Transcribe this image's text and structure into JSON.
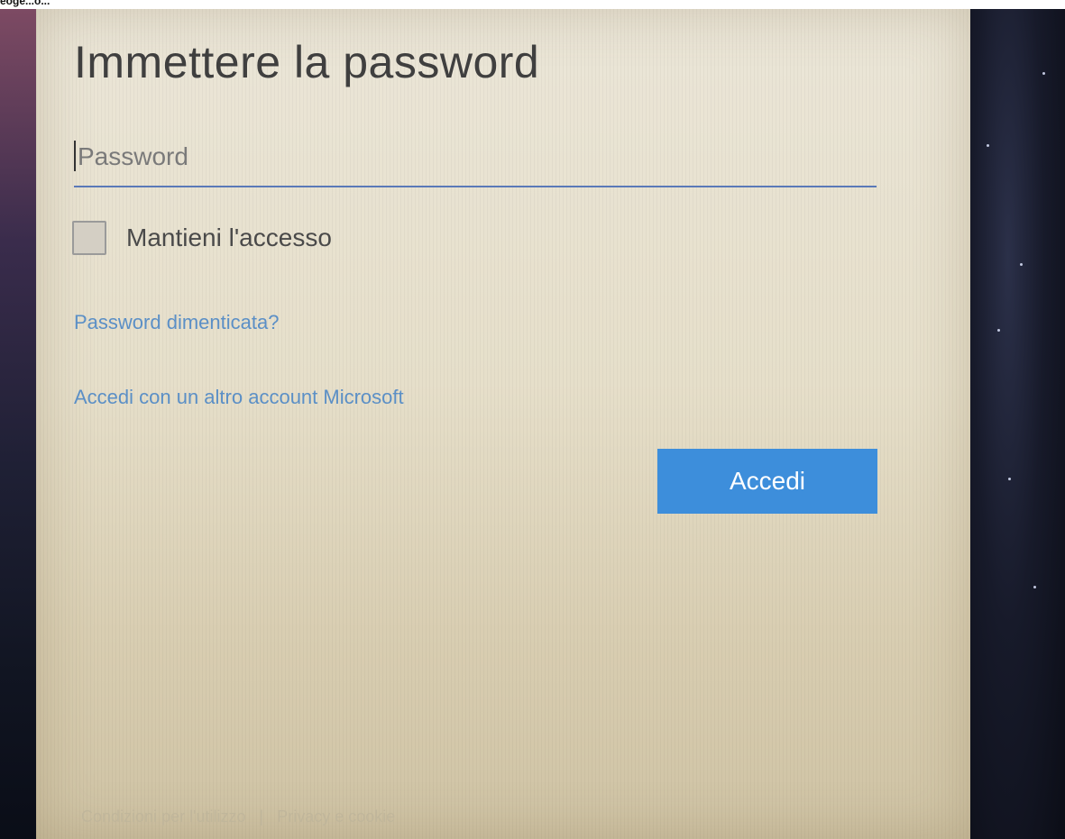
{
  "header": {
    "strip_label": "eoge...o..."
  },
  "login": {
    "title": "Immettere la password",
    "password": {
      "placeholder": "Password",
      "value": ""
    },
    "remember_me": {
      "label": "Mantieni l'accesso",
      "checked": false
    },
    "forgot_password_link": "Password dimenticata?",
    "other_account_link": "Accedi con un altro account Microsoft",
    "signin_button": "Accedi"
  },
  "footer": {
    "terms_link": "Condizioni per l'utilizzo",
    "separator": "|",
    "privacy_link": "Privacy e cookie"
  },
  "colors": {
    "accent": "#3d8edb",
    "link": "#5b8fc6",
    "underline": "#5a79b8",
    "panel_bg": "#e6dfca",
    "title_text": "#3f3f3f"
  },
  "icons": {
    "checkbox": "checkbox-unchecked-icon"
  }
}
